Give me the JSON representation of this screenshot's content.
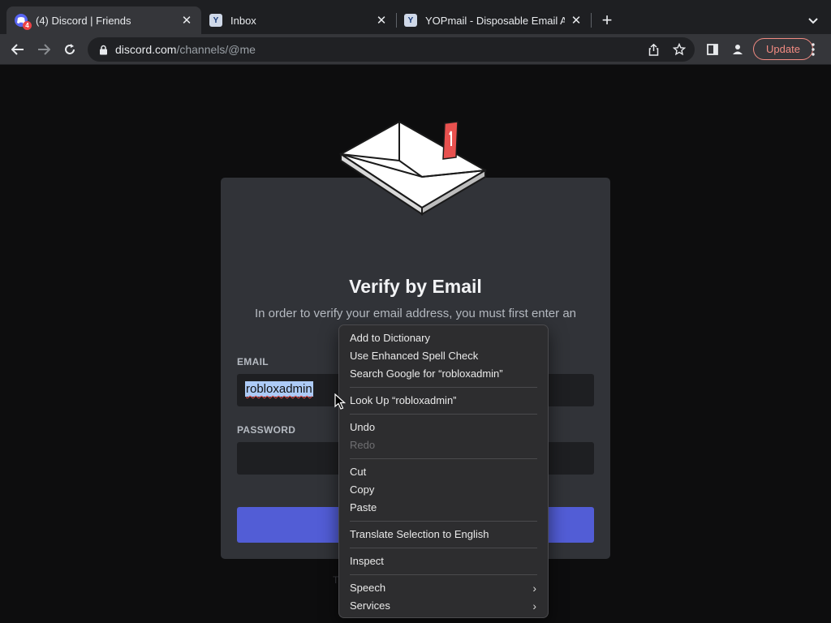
{
  "browser": {
    "tabs": [
      {
        "title": "(4) Discord | Friends",
        "badge": "4",
        "active": true
      },
      {
        "title": "Inbox",
        "active": false
      },
      {
        "title": "YOPmail - Disposable Email Ad",
        "active": false
      }
    ],
    "new_tab_label": "+",
    "close_label": "✕",
    "url_host": "discord.com",
    "url_path": "/channels/@me",
    "update_label": "Update",
    "colors": {
      "tab_bar": "#1e1f22",
      "toolbar": "#35363a",
      "update_accent": "#f28b82"
    }
  },
  "page": {
    "title": "Verify by Email",
    "subtitle": "In order to verify your email address, you must first enter an",
    "email_label": "EMAIL",
    "email_value": "robloxadmin",
    "password_label": "PASSWORD",
    "faint_text": "T",
    "colors": {
      "card": "#313338",
      "input": "#1e1f22",
      "button": "#5865f2"
    }
  },
  "context_menu": {
    "groups": [
      [
        {
          "label": "Add to Dictionary"
        },
        {
          "label": "Use Enhanced Spell Check"
        },
        {
          "label": "Search Google for “robloxadmin”"
        }
      ],
      [
        {
          "label": "Look Up “robloxadmin”"
        }
      ],
      [
        {
          "label": "Undo"
        },
        {
          "label": "Redo",
          "disabled": true
        }
      ],
      [
        {
          "label": "Cut"
        },
        {
          "label": "Copy"
        },
        {
          "label": "Paste"
        }
      ],
      [
        {
          "label": "Translate Selection to English"
        }
      ],
      [
        {
          "label": "Inspect"
        }
      ],
      [
        {
          "label": "Speech",
          "submenu": true
        },
        {
          "label": "Services",
          "submenu": true
        }
      ]
    ]
  }
}
